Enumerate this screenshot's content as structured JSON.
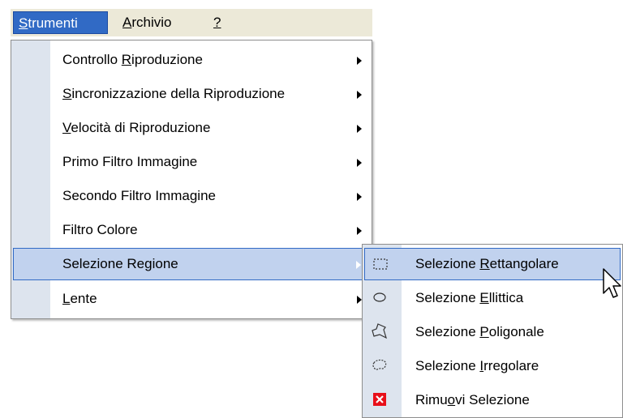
{
  "menubar": {
    "items": [
      {
        "pre": "",
        "u": "S",
        "post": "trumenti"
      },
      {
        "pre": "",
        "u": "A",
        "post": "rchivio"
      },
      {
        "pre": "",
        "u": "?",
        "post": ""
      }
    ]
  },
  "menu": {
    "items": [
      {
        "pre": "Controllo ",
        "u": "R",
        "post": "iproduzione"
      },
      {
        "pre": "",
        "u": "S",
        "post": "incronizzazione della Riproduzione"
      },
      {
        "pre": "",
        "u": "V",
        "post": "elocità di Riproduzione"
      },
      {
        "pre": "Primo Filtro Immagine",
        "u": "",
        "post": ""
      },
      {
        "pre": "Secondo Filtro Immagine",
        "u": "",
        "post": ""
      },
      {
        "pre": "Filtro Colore",
        "u": "",
        "post": ""
      },
      {
        "pre": "Selezione Re",
        "u": "g",
        "post": "ione"
      },
      {
        "pre": "",
        "u": "L",
        "post": "ente"
      }
    ]
  },
  "submenu": {
    "items": [
      {
        "pre": "Selezione ",
        "u": "R",
        "post": "ettangolare",
        "icon": "rect-select-icon"
      },
      {
        "pre": "Selezione ",
        "u": "E",
        "post": "llittica",
        "icon": "ellipse-select-icon"
      },
      {
        "pre": "Selezione ",
        "u": "P",
        "post": "oligonale",
        "icon": "polygon-select-icon"
      },
      {
        "pre": "Selezione ",
        "u": "I",
        "post": "rregolare",
        "icon": "freeform-select-icon"
      },
      {
        "pre": "Rimu",
        "u": "o",
        "post": "vi Selezione",
        "icon": "remove-selection-icon"
      }
    ]
  },
  "colors": {
    "menubar_bg": "#ece9d8",
    "highlight": "#316ac5",
    "item_highlight": "#c1d2ee",
    "gutter": "#dde4ee",
    "remove_icon": "#e8101a"
  }
}
